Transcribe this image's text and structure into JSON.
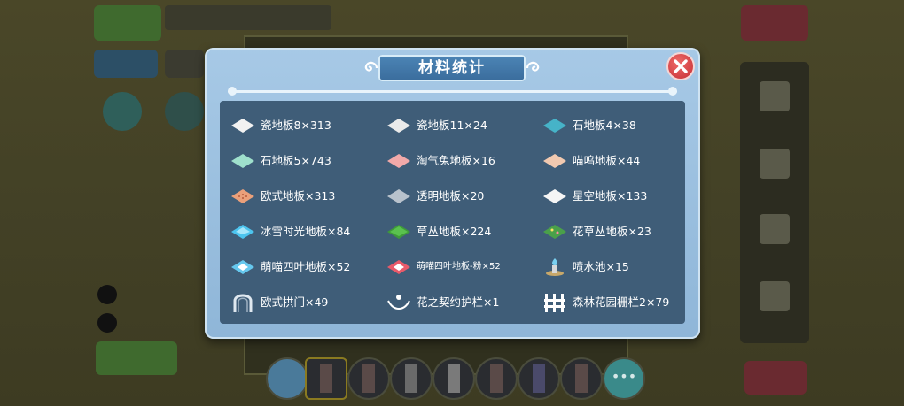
{
  "dialog": {
    "title": "材料统计",
    "items": [
      {
        "name": "瓷地板8×313",
        "icon": "white-tile-icon",
        "color": "#f2f2f2"
      },
      {
        "name": "瓷地板11×24",
        "icon": "white-tile-icon",
        "color": "#eaeaea"
      },
      {
        "name": "石地板4×38",
        "icon": "teal-tile-icon",
        "color": "#46b3c8"
      },
      {
        "name": "石地板5×743",
        "icon": "mint-tile-icon",
        "color": "#9fe0cc"
      },
      {
        "name": "淘气兔地板×16",
        "icon": "pink-tile-icon",
        "color": "#f2a9a9"
      },
      {
        "name": "喵呜地板×44",
        "icon": "peach-tile-icon",
        "color": "#f1c9b0"
      },
      {
        "name": "欧式地板×313",
        "icon": "orange-pattern-tile-icon",
        "color": "#eba07a"
      },
      {
        "name": "透明地板×20",
        "icon": "gray-tile-icon",
        "color": "#b8c2cc"
      },
      {
        "name": "星空地板×133",
        "icon": "white-tile-icon",
        "color": "#f5f5f5"
      },
      {
        "name": "冰雪时光地板×84",
        "icon": "ice-tile-icon",
        "color": "#4cc4ee"
      },
      {
        "name": "草丛地板×224",
        "icon": "grass-tile-icon",
        "color": "#3e9a3a"
      },
      {
        "name": "花草丛地板×23",
        "icon": "flower-grass-tile-icon",
        "color": "#4aa04a"
      },
      {
        "name": "萌喵四叶地板×52",
        "icon": "clover-tile-icon",
        "color": "#66c8ee"
      },
      {
        "name": "萌喵四叶地板-粉×52",
        "icon": "pink-clover-tile-icon",
        "color": "#e85a6a"
      },
      {
        "name": "喷水池×15",
        "icon": "fountain-icon",
        "color": "#7ad0f0"
      },
      {
        "name": "欧式拱门×49",
        "icon": "arch-icon",
        "color": "#dfe8f0"
      },
      {
        "name": "花之契约护栏×1",
        "icon": "flower-rail-icon",
        "color": "#ffffff"
      },
      {
        "name": "森林花园栅栏2×79",
        "icon": "fence-icon",
        "color": "#ffffff"
      }
    ]
  }
}
